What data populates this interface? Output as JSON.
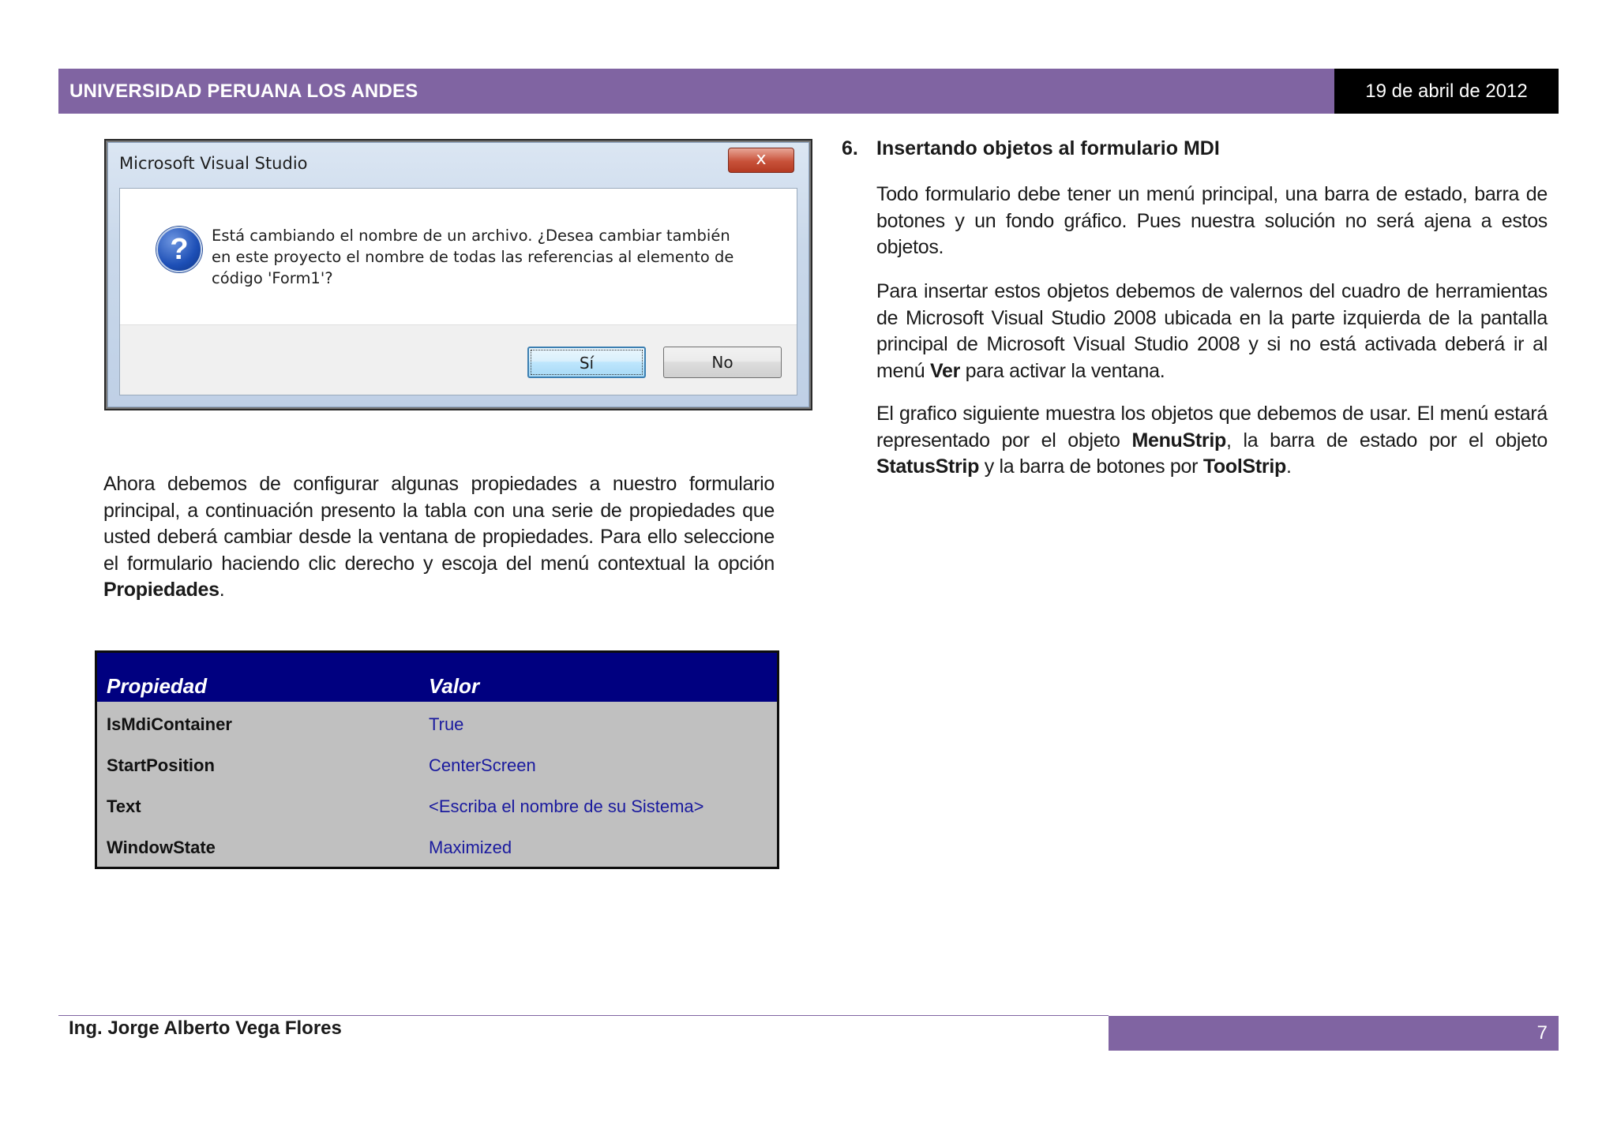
{
  "header": {
    "institution": "UNIVERSIDAD PERUANA LOS ANDES",
    "date": "19 de abril de 2012"
  },
  "dialog": {
    "title": "Microsoft Visual Studio",
    "close_glyph": "x",
    "icon": "question-icon",
    "message": "Está cambiando el nombre de un archivo. ¿Desea cambiar también en este proyecto el nombre de todas las referencias al elemento de código 'Form1'?",
    "yes_label": "Sí",
    "no_label": "No"
  },
  "left_paragraph": {
    "text": "Ahora debemos de configurar algunas propiedades a nuestro formulario principal, a continuación presento la tabla con una serie de propiedades que usted deberá cambiar desde la ventana de propiedades. Para ello seleccione el formulario haciendo clic derecho y escoja del menú contextual la opción ",
    "bold": "Propiedades",
    "end": "."
  },
  "properties_table": {
    "headers": [
      "Propiedad",
      "Valor"
    ],
    "rows": [
      [
        "IsMdiContainer",
        "True"
      ],
      [
        "StartPosition",
        "CenterScreen"
      ],
      [
        "Text",
        "<Escriba el nombre de su Sistema>"
      ],
      [
        "WindowState",
        "Maximized"
      ]
    ]
  },
  "section": {
    "number": "6.",
    "title": "Insertando objetos al formulario MDI",
    "p1": "Todo formulario debe tener un menú principal, una barra de estado, barra de botones y un fondo gráfico. Pues nuestra solución no será ajena a estos objetos.",
    "p2_a": "Para insertar estos objetos debemos de valernos del cuadro de herramientas de Microsoft Visual Studio 2008 ubicada en la parte izquierda de la pantalla principal de Microsoft Visual Studio 2008 y si no está activada deberá ir al menú ",
    "p2_bold": "Ver",
    "p2_b": " para activar la ventana.",
    "p3_a": "El grafico siguiente muestra los objetos que debemos de usar. El menú estará representado por el objeto ",
    "p3_bold1": "MenuStrip",
    "p3_b": ", la barra de estado por el objeto ",
    "p3_bold2": "StatusStrip",
    "p3_c": " y la barra de botones por ",
    "p3_bold3": "ToolStrip",
    "p3_d": "."
  },
  "footer": {
    "author": "Ing. Jorge Alberto Vega Flores",
    "page": "7"
  },
  "colors": {
    "accent_purple": "#8064a2",
    "table_header": "#000080",
    "table_body": "#c0c0c0",
    "value_text": "#1a1a9e"
  }
}
